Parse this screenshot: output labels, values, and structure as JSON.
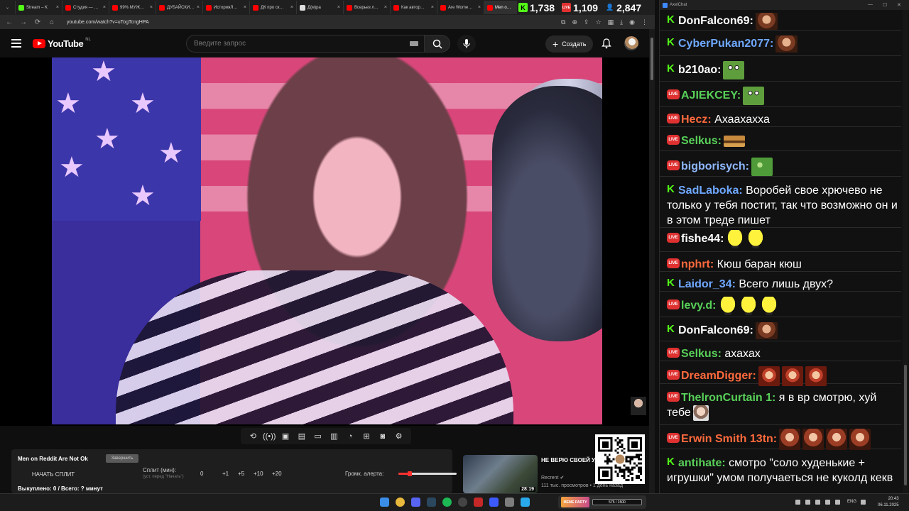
{
  "browser": {
    "tabs": [
      {
        "label": "Stream – K",
        "color": "#53fc18"
      },
      {
        "label": "Студия — …",
        "color": "#ff0000"
      },
      {
        "label": "99% МУЖ…",
        "color": "#ff0000"
      },
      {
        "label": "ДУБАЙСКИ…",
        "color": "#ff0000"
      },
      {
        "label": "ИсторияЛ…",
        "color": "#ff0000"
      },
      {
        "label": "ДК про ск…",
        "color": "#ff0000"
      },
      {
        "label": "Д(м)ра",
        "color": "#dddddd"
      },
      {
        "label": "Всерьез л…",
        "color": "#ff0000"
      },
      {
        "label": "Как автор…",
        "color": "#ff0000"
      },
      {
        "label": "Are Wome…",
        "color": "#ff0000"
      },
      {
        "label": "Men o…",
        "color": "#ff0000",
        "active": true
      }
    ],
    "url": "youtube.com/watch?v=uTogTcngHPA",
    "counters": [
      {
        "platform": "kick",
        "value": "1,738"
      },
      {
        "platform": "live",
        "value": "1,109"
      },
      {
        "platform": "viewers",
        "value": "2,847"
      }
    ]
  },
  "youtube": {
    "logo_text": "YouTube",
    "country_code": "NL",
    "search_placeholder": "Введите запрос",
    "create_label": "Создать"
  },
  "split_widget": {
    "title": "Men on Reddit Are Not Ok",
    "badge": "Завершить",
    "start_label": "НАЧАТЬ СПЛИТ",
    "min_label": "Сплит (мин):",
    "min_hint": "(уст. перед \"Начать\")",
    "value": "0",
    "increments": [
      "+1",
      "+5",
      "+10",
      "+20"
    ],
    "alert_label": "Громк. алерта:",
    "alert_level": 0.2,
    "footer": "Выкуплено: 0 / Всего: ? минут"
  },
  "recommended": {
    "title": "НЕ ВЕРЮ СВОЕЙ УДАЧЕ RAIDERS",
    "channel": "Recrent",
    "meta": "111 тыс. просмотров • 1 день назад",
    "duration": "28:19"
  },
  "taskbar": {
    "widget_label": "MEME PARTY",
    "widget_bar": "575 / 1500",
    "lang": "ENG",
    "time": "20:43",
    "date": "06.11.2025"
  },
  "chat": {
    "window_title": "AxelChat",
    "messages": [
      {
        "platform": "kick",
        "user": "DonFalcon69:",
        "user_color": "#ffffff",
        "text": "",
        "emotes": [
          "face"
        ]
      },
      {
        "platform": "kick",
        "user": "CyberPukan2077:",
        "user_color": "#6fa8ff",
        "text": "",
        "emotes": [
          "face"
        ]
      },
      {
        "platform": "kick",
        "user": "b210ao:",
        "user_color": "#ffffff",
        "text": "",
        "emotes": [
          "frog"
        ]
      },
      {
        "platform": "live",
        "user": "AJIEKCEY:",
        "user_color": "#58d058",
        "text": "",
        "emotes": [
          "frog"
        ]
      },
      {
        "platform": "live",
        "user": "Hecz:",
        "user_color": "#ff6a3d",
        "text": "Ахаахахха",
        "emotes": []
      },
      {
        "platform": "live",
        "user": "Selkus:",
        "user_color": "#58d058",
        "text": "",
        "emotes": [
          "burger"
        ]
      },
      {
        "platform": "live",
        "user": "bigborisych:",
        "user_color": "#8fb8ff",
        "text": "",
        "emotes": [
          "pepe"
        ]
      },
      {
        "platform": "kick",
        "user": "SadLaboka:",
        "user_color": "#6fa8ff",
        "text": "Воробей свое хрючево не только у тебя постит, так что возможно он и в этом треде пишет",
        "emotes": []
      },
      {
        "platform": "live",
        "user": "fishe44:",
        "user_color": "#ffffff",
        "text": "",
        "emotes": [
          "yellow",
          "yellow"
        ]
      },
      {
        "platform": "live",
        "user": "nphrt:",
        "user_color": "#ff6a3d",
        "text": "Кюш баран кюш",
        "emotes": []
      },
      {
        "platform": "kick",
        "user": "Laidor_34:",
        "user_color": "#6fa8ff",
        "text": "Всего лишь двух?",
        "emotes": []
      },
      {
        "platform": "live",
        "user": "levy.d:",
        "user_color": "#58d058",
        "text": "",
        "emotes": [
          "yellow",
          "yellow",
          "yellow"
        ]
      },
      {
        "platform": "kick",
        "user": "DonFalcon69:",
        "user_color": "#ffffff",
        "text": "",
        "emotes": [
          "face"
        ]
      },
      {
        "platform": "live",
        "user": "Selkus:",
        "user_color": "#58d058",
        "text": "ахахах",
        "emotes": []
      },
      {
        "platform": "live",
        "user": "DreamDigger:",
        "user_color": "#ff6a3d",
        "text": "",
        "emotes": [
          "scream",
          "scream",
          "scream"
        ]
      },
      {
        "platform": "live",
        "user": "ThelronCurtain 1:",
        "user_color": "#58d058",
        "text": "я в вр смотрю, хуй тебе",
        "emotes": [
          "man"
        ]
      },
      {
        "platform": "live",
        "user": "Erwin Smith 13tn:",
        "user_color": "#ff6a3d",
        "text": "",
        "emotes": [
          "sweat",
          "sweat",
          "sweat",
          "sweat"
        ]
      },
      {
        "platform": "kick",
        "user": "antihate:",
        "user_color": "#58d058",
        "text": "смотро \"соло худенькие + игрушки\" умом получаеться не куколд кекв",
        "emotes": []
      }
    ]
  }
}
